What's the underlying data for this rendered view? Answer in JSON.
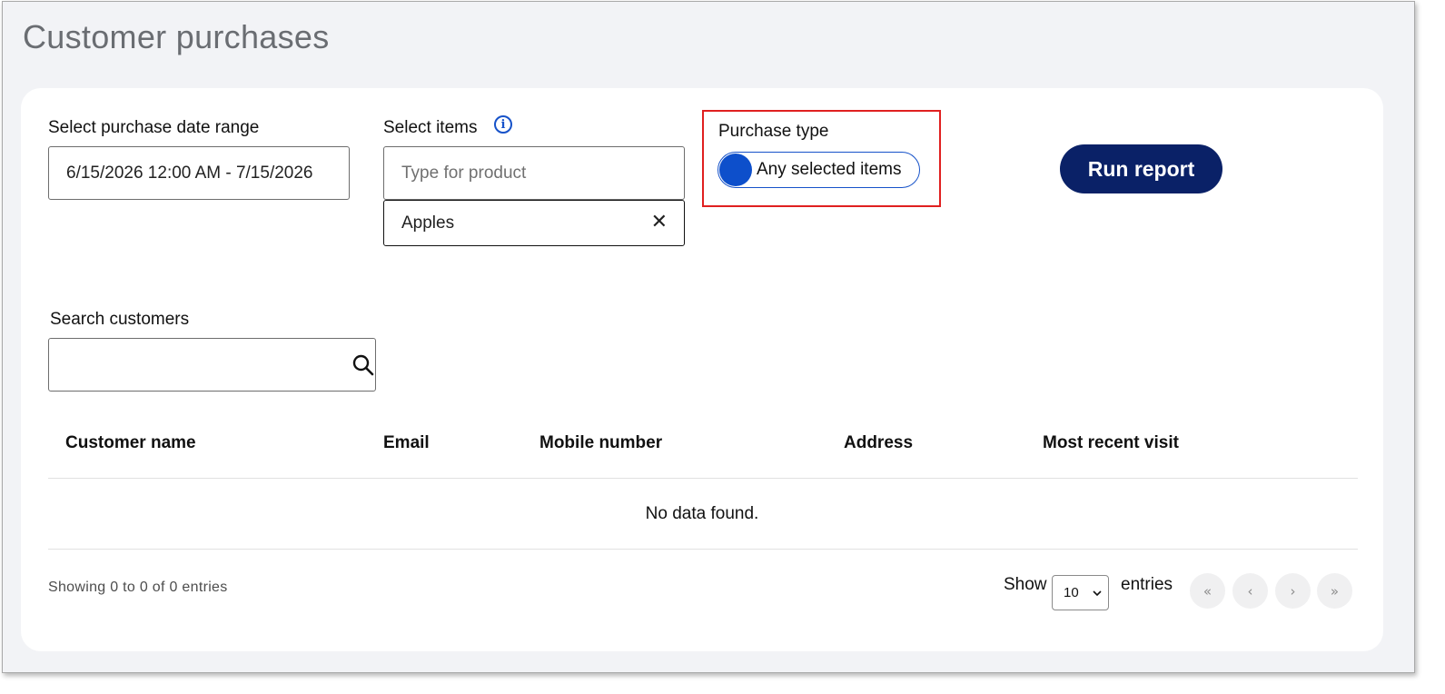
{
  "page_title": "Customer purchases",
  "date_range": {
    "label": "Select purchase date range",
    "value": "6/15/2026 12:00 AM - 7/15/2026"
  },
  "items": {
    "label": "Select items",
    "info_icon": "info-circle",
    "placeholder": "Type for product",
    "selected": [
      "Apples"
    ],
    "remove_symbol": "✕"
  },
  "purchase_type": {
    "label": "Purchase type",
    "toggle_label": "Any selected items",
    "toggle_color": "#0d4fcb",
    "highlight_color": "#e02020"
  },
  "run_report": {
    "label": "Run report",
    "color": "#0a2167"
  },
  "search_customers": {
    "label": "Search customers",
    "value": "",
    "icon": "search-icon"
  },
  "table": {
    "columns": [
      "Customer name",
      "Email",
      "Mobile number",
      "Address",
      "Most recent visit"
    ],
    "rows": [],
    "empty_message": "No data found."
  },
  "footer": {
    "showing": "Showing 0 to 0 of 0 entries",
    "show_label": "Show",
    "entries_label": "entries",
    "page_length": "10",
    "pagination": [
      "«",
      "‹",
      "›",
      "»"
    ]
  }
}
